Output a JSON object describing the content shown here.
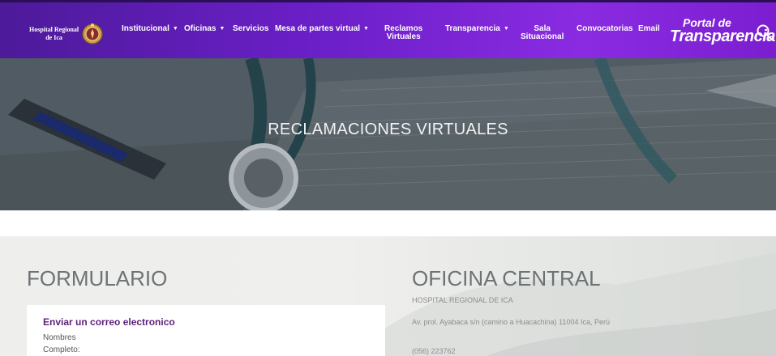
{
  "brand": {
    "line1": "Hospital Regional",
    "line2": "de Ica"
  },
  "nav": {
    "items": [
      {
        "label": "Institucional",
        "caret": true
      },
      {
        "label": "Oficinas",
        "caret": true
      },
      {
        "label": "Servicios",
        "caret": false
      },
      {
        "label": "Mesa de partes virtual",
        "caret": true
      },
      {
        "label": "Reclamos",
        "label2": "Virtuales",
        "caret": false
      },
      {
        "label": "Transparencia",
        "caret": true
      },
      {
        "label": "Sala",
        "label2": "Situacional",
        "caret": false
      },
      {
        "label": "Convocatorias",
        "caret": false
      },
      {
        "label": "Email",
        "caret": false
      }
    ],
    "portal": {
      "line1": "Portal de",
      "line2": "Transparencia"
    }
  },
  "hero": {
    "title": "RECLAMACIONES VIRTUALES"
  },
  "form": {
    "heading": "FORMULARIO",
    "card_title": "Enviar un correo electronico",
    "label_nombres": "Nombres",
    "label_completo": "Completo:"
  },
  "office": {
    "heading": "OFICINA CENTRAL",
    "name": "HOSPITAL REGIONAL DE ICA",
    "address": "Av. prol. Ayabaca s/n (camino a Huacachina) 11004 Ica, Perú",
    "phone": "(056) 223762"
  },
  "colors": {
    "nav_start": "#4d1a9a",
    "nav_end": "#8a2be2",
    "card_title": "#5d1f7a"
  }
}
